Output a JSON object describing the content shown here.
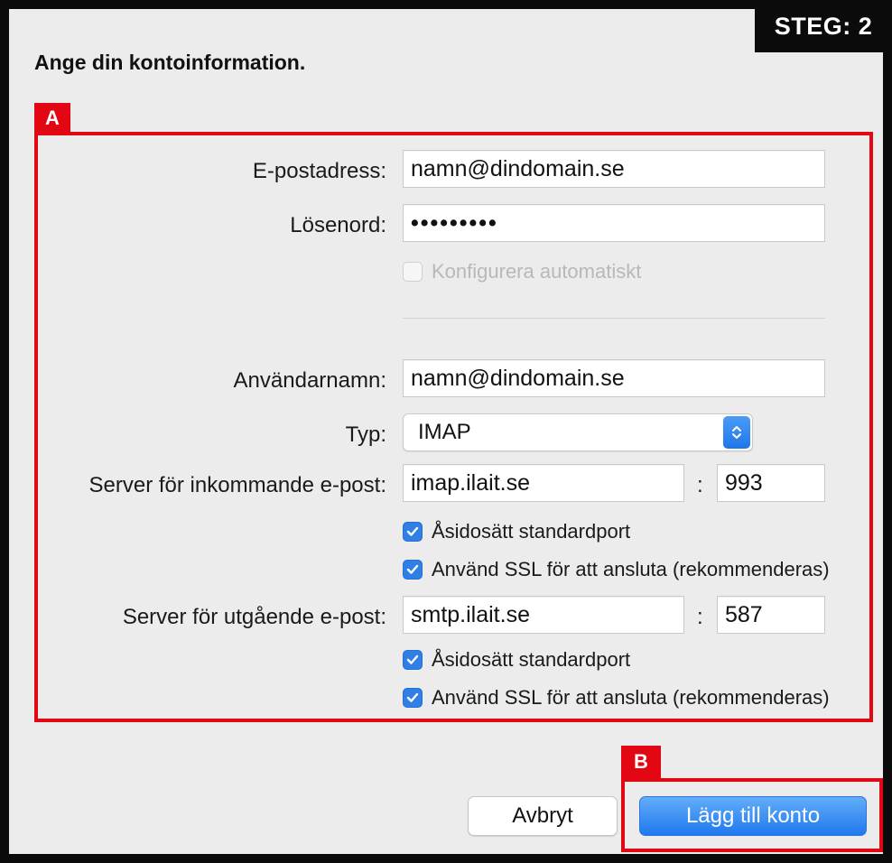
{
  "step_badge": "STEG: 2",
  "heading": "Ange din kontoinformation.",
  "markers": {
    "a": "A",
    "b": "B"
  },
  "form": {
    "email": {
      "label": "E-postadress:",
      "value": "namn@dindomain.se"
    },
    "password": {
      "label": "Lösenord:",
      "value": "•••••••••"
    },
    "auto_config": {
      "label": "Konfigurera automatiskt",
      "checked": false,
      "disabled": true
    },
    "username": {
      "label": "Användarnamn:",
      "value": "namn@dindomain.se"
    },
    "type": {
      "label": "Typ:",
      "selected": "IMAP"
    },
    "incoming": {
      "label": "Server för inkommande e-post:",
      "server": "imap.ilait.se",
      "separator": ":",
      "port": "993",
      "override_port": {
        "label": "Åsidosätt standardport",
        "checked": true
      },
      "use_ssl": {
        "label": "Använd SSL för att ansluta (rekommenderas)",
        "checked": true
      }
    },
    "outgoing": {
      "label": "Server för utgående e-post:",
      "server": "smtp.ilait.se",
      "separator": ":",
      "port": "587",
      "override_port": {
        "label": "Åsidosätt standardport",
        "checked": true
      },
      "use_ssl": {
        "label": "Använd SSL för att ansluta (rekommenderas)",
        "checked": true
      }
    }
  },
  "buttons": {
    "cancel": "Avbryt",
    "add_account": "Lägg till konto"
  },
  "colors": {
    "highlight_red": "#e30613",
    "accent_blue": "#2f7fe6",
    "frame_black": "#0b0b0b"
  },
  "icons": {
    "checkmark": "checkmark-icon",
    "select_arrows": "chevron-up-down-icon"
  }
}
